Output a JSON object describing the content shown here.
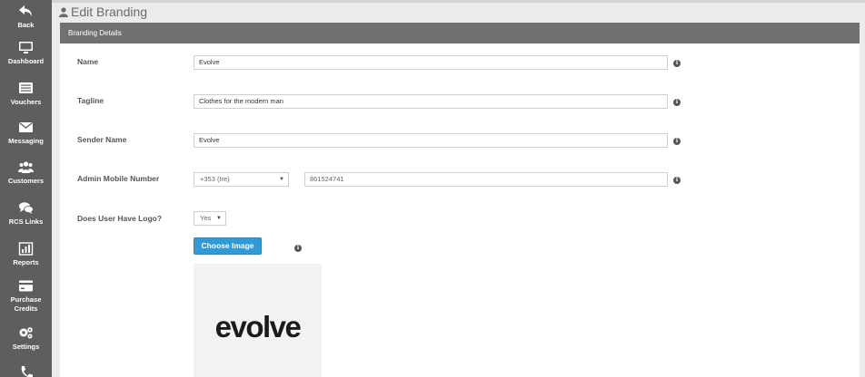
{
  "sidebar": {
    "items": [
      {
        "label": "Back",
        "icon": "back-arrow-icon"
      },
      {
        "label": "Dashboard",
        "icon": "monitor-icon"
      },
      {
        "label": "Vouchers",
        "icon": "voucher-icon"
      },
      {
        "label": "Messaging",
        "icon": "envelope-icon"
      },
      {
        "label": "Customers",
        "icon": "users-icon"
      },
      {
        "label": "RCS Links",
        "icon": "chat-bubbles-icon"
      },
      {
        "label": "Reports",
        "icon": "bar-chart-icon"
      },
      {
        "label": "Purchase",
        "label2": "Credits",
        "icon": "credit-card-icon"
      },
      {
        "label": "Settings",
        "icon": "gears-icon"
      }
    ]
  },
  "header": {
    "title": "Edit Branding"
  },
  "panel": {
    "title": "Branding Details"
  },
  "form": {
    "name": {
      "label": "Name",
      "value": "Evolve"
    },
    "tagline": {
      "label": "Tagline",
      "value": "Clothes for the modern man"
    },
    "sender_name": {
      "label": "Sender Name",
      "value": "Evolve"
    },
    "admin_mobile": {
      "label": "Admin Mobile Number",
      "country_code": "+353 (Ire)",
      "number": "861524741"
    },
    "has_logo": {
      "label": "Does User Have Logo?",
      "value": "Yes"
    },
    "choose_image_label": "Choose Image",
    "logo_text": "evolve"
  },
  "colors": {
    "sidebar": "#5e5e5e",
    "panel_header": "#707070",
    "primary_button": "#2f9bd6"
  }
}
